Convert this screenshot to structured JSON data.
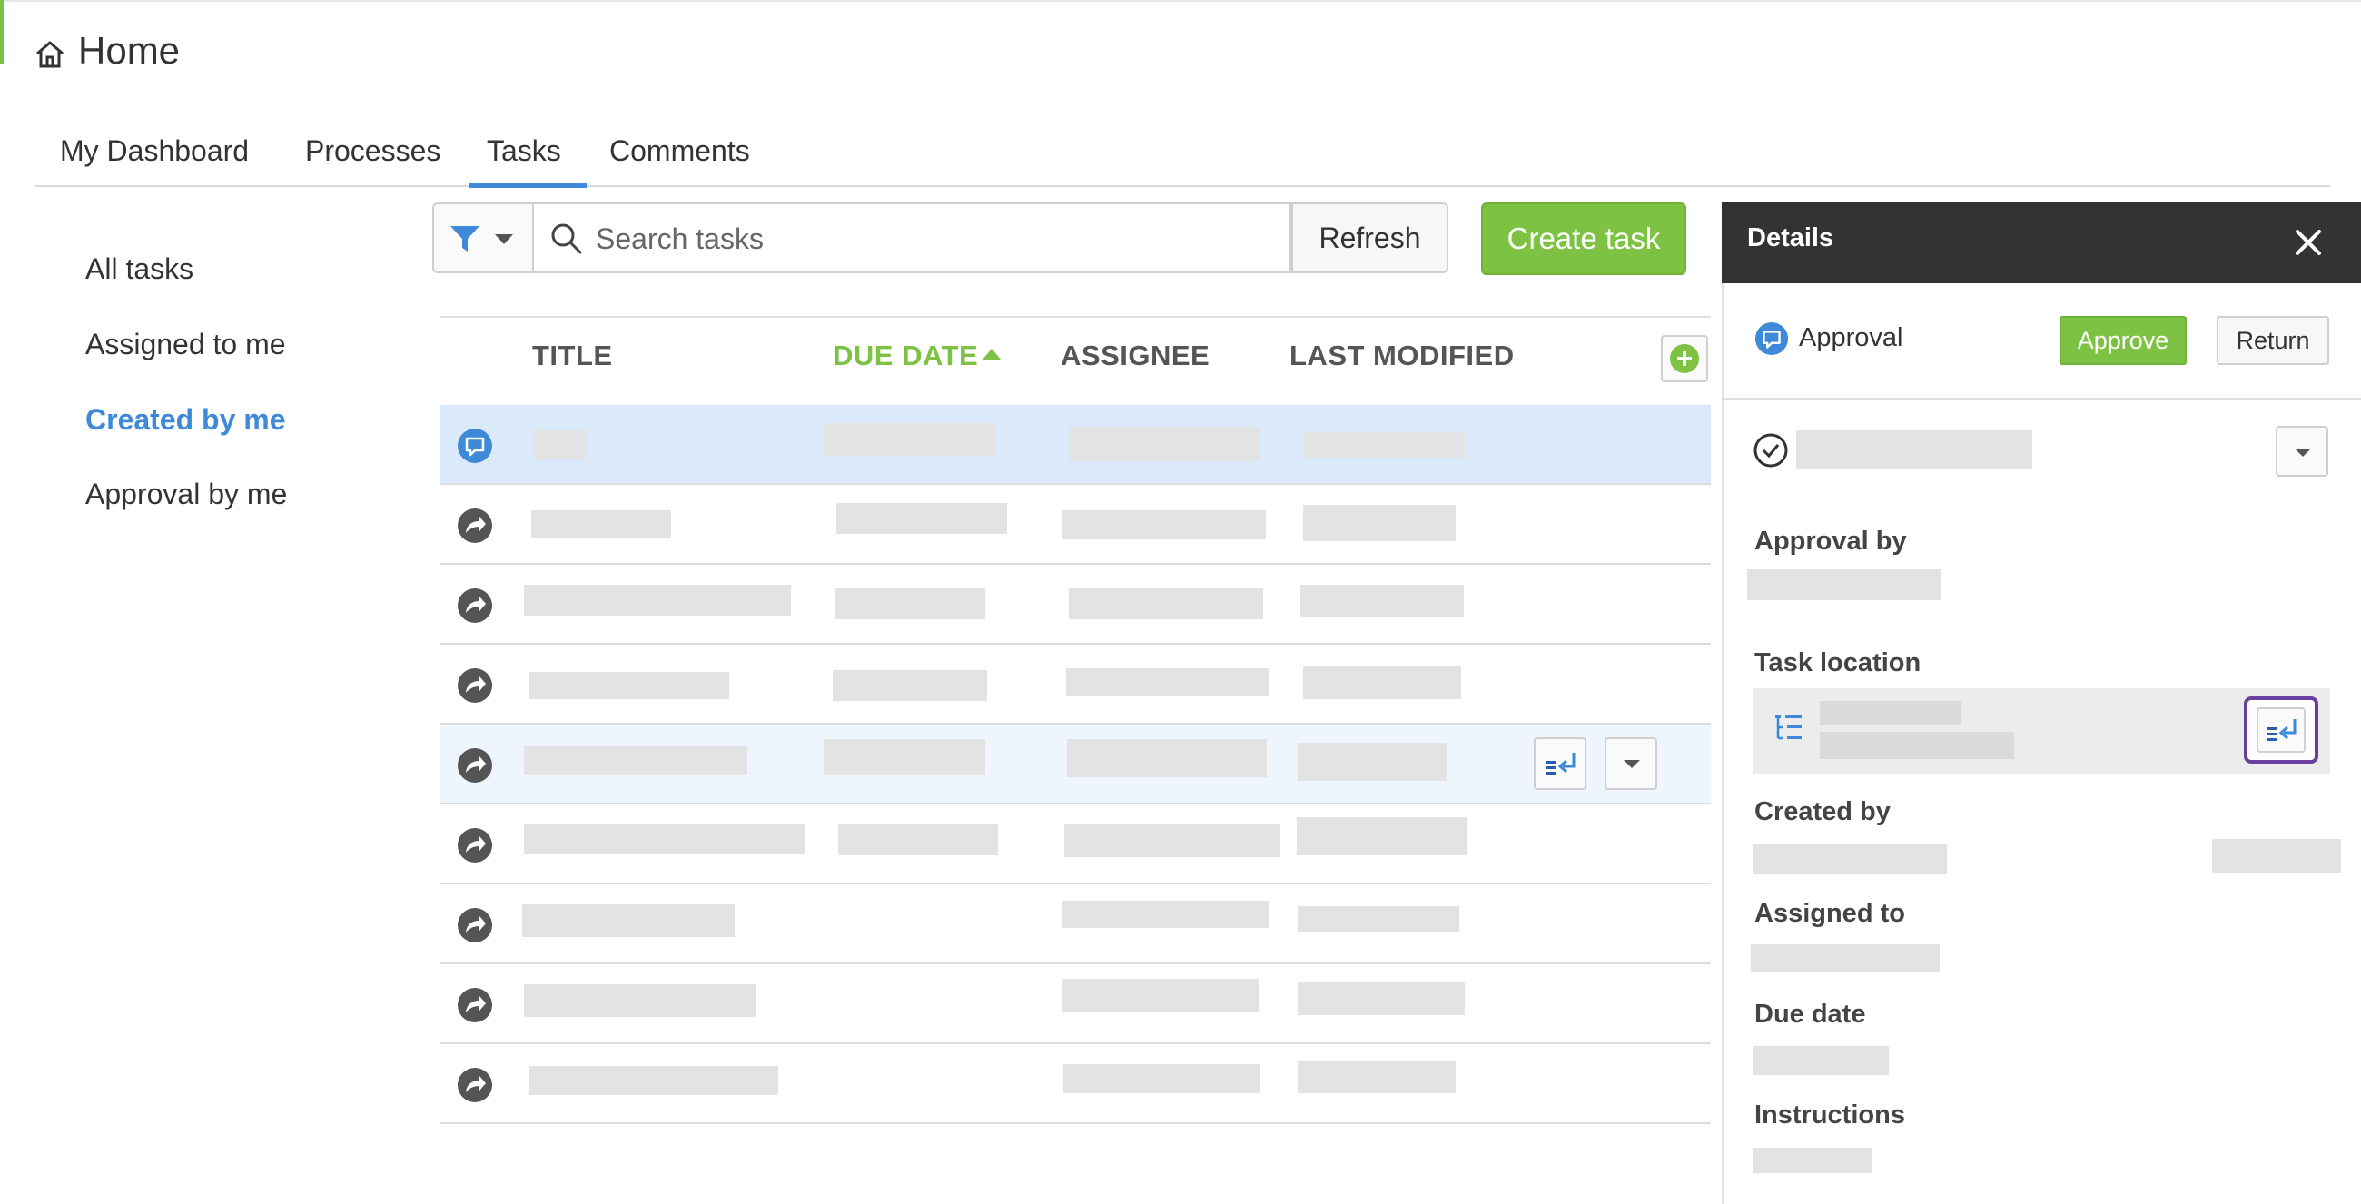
{
  "header": {
    "title": "Home",
    "icon": "home-icon"
  },
  "tabs": [
    {
      "label": "My Dashboard",
      "active": false
    },
    {
      "label": "Processes",
      "active": false
    },
    {
      "label": "Tasks",
      "active": true
    },
    {
      "label": "Comments",
      "active": false
    }
  ],
  "nav": [
    {
      "label": "All tasks",
      "active": false
    },
    {
      "label": "Assigned to me",
      "active": false
    },
    {
      "label": "Created by me",
      "active": true
    },
    {
      "label": "Approval by me",
      "active": false
    }
  ],
  "toolbar": {
    "search_placeholder": "Search tasks",
    "refresh_label": "Refresh",
    "create_label": "Create task"
  },
  "table": {
    "columns": [
      "TITLE",
      "DUE DATE",
      "ASSIGNEE",
      "LAST MODIFIED"
    ],
    "sorted_column": "DUE DATE",
    "sort_direction": "ascending",
    "rows": [
      {
        "type": "approval",
        "state": "selected"
      },
      {
        "type": "task",
        "state": "normal"
      },
      {
        "type": "task",
        "state": "normal"
      },
      {
        "type": "task",
        "state": "normal"
      },
      {
        "type": "task",
        "state": "hover"
      },
      {
        "type": "task",
        "state": "normal"
      },
      {
        "type": "task",
        "state": "normal"
      },
      {
        "type": "task",
        "state": "normal"
      },
      {
        "type": "task",
        "state": "normal"
      }
    ]
  },
  "details": {
    "title": "Details",
    "task_type": "Approval",
    "approve_label": "Approve",
    "return_label": "Return",
    "fields": {
      "approval_by": "Approval by",
      "task_location": "Task location",
      "created_by": "Created by",
      "assigned_to": "Assigned to",
      "due_date": "Due date",
      "instructions": "Instructions"
    }
  },
  "colors": {
    "accent_blue": "#3f8ad8",
    "accent_green": "#7dc242",
    "panel_header": "#333333",
    "selected_row": "#dbeafb",
    "focus_outline": "#6b3fa0"
  }
}
